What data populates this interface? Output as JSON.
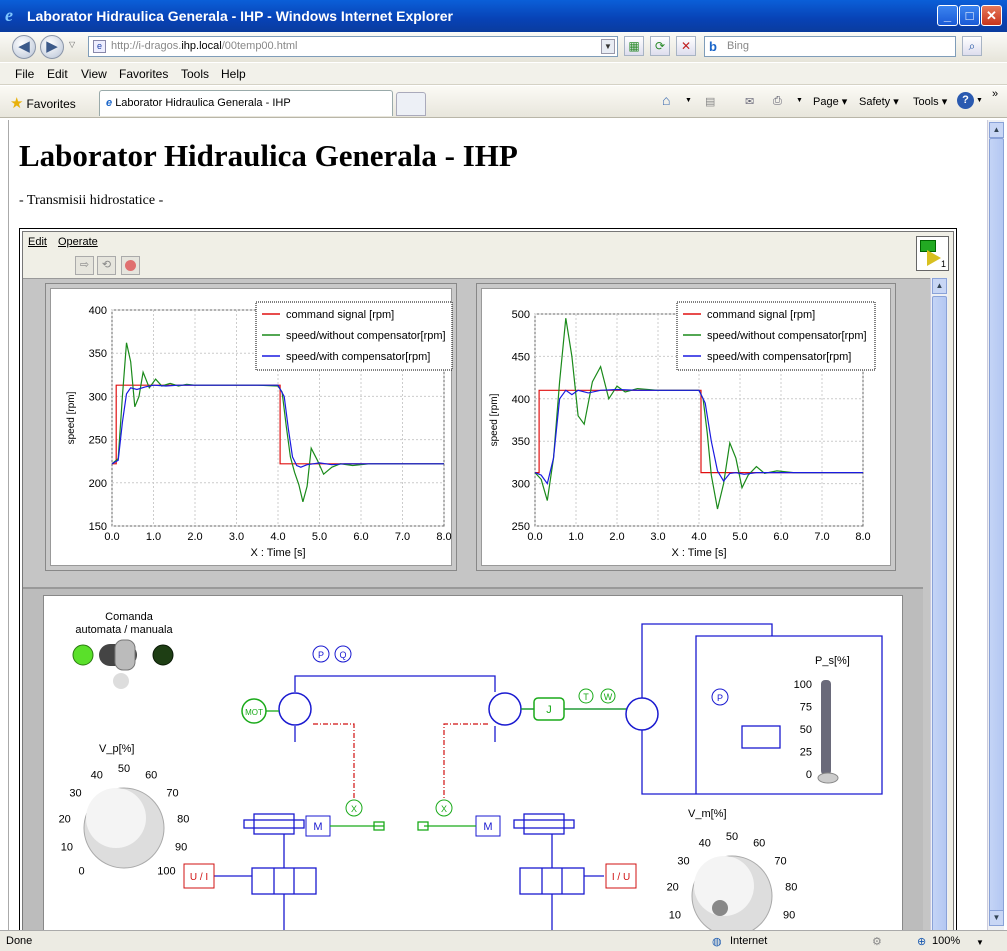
{
  "window": {
    "title": "Laborator Hidraulica Generala - IHP - Windows Internet Explorer"
  },
  "address": {
    "prefix": "http://i-dragos.",
    "host": "ihp.local",
    "path": "/00temp00.html"
  },
  "search": {
    "placeholder": "Bing"
  },
  "menu": [
    "File",
    "Edit",
    "View",
    "Favorites",
    "Tools",
    "Help"
  ],
  "favorites": {
    "label": "Favorites",
    "tab_title": "Laborator Hidraulica Generala - IHP"
  },
  "commandbar": {
    "page": "Page",
    "safety": "Safety",
    "tools": "Tools"
  },
  "page": {
    "title": "Laborator Hidraulica Generala - IHP",
    "subtitle": "- Transmisii hidrostatice -"
  },
  "vi": {
    "menu": [
      "Edit",
      "Operate"
    ],
    "icon_label": "1",
    "switch_label_1": "Comanda",
    "switch_label_2": "automata / manuala",
    "knob_pump_label": "V_p[%]",
    "knob_motor_label": "V_m[%]",
    "slider_label": "P_s[%]",
    "knob_ticks": [
      "0",
      "10",
      "20",
      "30",
      "40",
      "50",
      "60",
      "70",
      "80",
      "90",
      "100"
    ],
    "slider_ticks": [
      "100",
      "75",
      "50",
      "25",
      "0"
    ],
    "blocks": {
      "mot": "MOT",
      "m": "M",
      "j": "J",
      "p": "P",
      "q": "Q",
      "t": "T",
      "w": "W",
      "x": "X",
      "ui": "U / I",
      "iu": "I / U"
    }
  },
  "chart_data": [
    {
      "type": "line",
      "xlabel": "X : Time [s]",
      "ylabel": "speed [rpm]",
      "xlim": [
        0,
        8
      ],
      "ylim": [
        150,
        400
      ],
      "xticks": [
        "0.0",
        "1.0",
        "2.0",
        "3.0",
        "4.0",
        "5.0",
        "6.0",
        "7.0",
        "8.0"
      ],
      "yticks": [
        "150",
        "200",
        "250",
        "300",
        "350",
        "400"
      ],
      "legend_position": "top-right",
      "series": [
        {
          "name": "command signal [rpm]",
          "color": "#e01010",
          "x": [
            0,
            0.1,
            0.1,
            4.05,
            4.05,
            8
          ],
          "y": [
            222,
            222,
            313,
            313,
            222,
            222
          ]
        },
        {
          "name": "speed/without compensator[rpm]",
          "color": "#1a8a1a",
          "x": [
            0,
            0.15,
            0.25,
            0.35,
            0.45,
            0.55,
            0.65,
            0.75,
            0.9,
            1.05,
            1.2,
            1.4,
            1.6,
            1.8,
            2.0,
            2.5,
            3.0,
            3.5,
            4.0,
            4.1,
            4.2,
            4.3,
            4.4,
            4.5,
            4.6,
            4.7,
            4.8,
            4.95,
            5.1,
            5.3,
            5.5,
            5.8,
            6.2,
            7,
            8
          ],
          "y": [
            222,
            228,
            300,
            362,
            340,
            288,
            300,
            328,
            310,
            320,
            312,
            315,
            312,
            314,
            313,
            313,
            313,
            313,
            312,
            305,
            265,
            230,
            212,
            198,
            178,
            196,
            240,
            226,
            210,
            218,
            222,
            220,
            222,
            222,
            222
          ]
        },
        {
          "name": "speed/with compensator[rpm]",
          "color": "#1a1ae0",
          "x": [
            0,
            0.15,
            0.25,
            0.35,
            0.45,
            0.6,
            0.8,
            1.0,
            1.3,
            1.6,
            2.0,
            3.0,
            4.0,
            4.15,
            4.25,
            4.35,
            4.45,
            4.55,
            4.7,
            4.85,
            5.0,
            5.3,
            5.6,
            6.0,
            7,
            8
          ],
          "y": [
            222,
            226,
            270,
            303,
            310,
            308,
            311,
            313,
            312,
            313,
            313,
            313,
            313,
            300,
            262,
            230,
            220,
            218,
            221,
            222,
            223,
            221,
            222,
            222,
            222,
            222
          ]
        }
      ]
    },
    {
      "type": "line",
      "xlabel": "X : Time [s]",
      "ylabel": "speed [rpm]",
      "xlim": [
        0,
        8
      ],
      "ylim": [
        250,
        500
      ],
      "xticks": [
        "0.0",
        "1.0",
        "2.0",
        "3.0",
        "4.0",
        "5.0",
        "6.0",
        "7.0",
        "8.0"
      ],
      "yticks": [
        "250",
        "300",
        "350",
        "400",
        "450",
        "500"
      ],
      "legend_position": "top-right",
      "series": [
        {
          "name": "command signal [rpm]",
          "color": "#e01010",
          "x": [
            0,
            0.1,
            0.1,
            4.05,
            4.05,
            8
          ],
          "y": [
            313,
            313,
            410,
            410,
            313,
            313
          ]
        },
        {
          "name": "speed/without compensator[rpm]",
          "color": "#1a8a1a",
          "x": [
            0,
            0.15,
            0.3,
            0.45,
            0.6,
            0.75,
            0.9,
            1.05,
            1.2,
            1.4,
            1.6,
            1.8,
            2.0,
            2.2,
            2.5,
            3.0,
            3.5,
            4.0,
            4.1,
            4.2,
            4.3,
            4.45,
            4.6,
            4.75,
            4.9,
            5.05,
            5.2,
            5.4,
            5.6,
            5.9,
            6.3,
            7,
            8
          ],
          "y": [
            313,
            305,
            280,
            330,
            420,
            495,
            450,
            380,
            370,
            420,
            438,
            400,
            415,
            408,
            412,
            410,
            410,
            410,
            400,
            360,
            310,
            270,
            300,
            348,
            330,
            295,
            310,
            320,
            312,
            315,
            313,
            313,
            313
          ]
        },
        {
          "name": "speed/with compensator[rpm]",
          "color": "#1a1ae0",
          "x": [
            0,
            0.15,
            0.3,
            0.45,
            0.6,
            0.75,
            0.9,
            1.05,
            1.3,
            1.6,
            2.0,
            2.5,
            3.0,
            4.0,
            4.15,
            4.3,
            4.45,
            4.6,
            4.75,
            4.9,
            5.1,
            5.4,
            6,
            7,
            8
          ],
          "y": [
            313,
            310,
            300,
            330,
            400,
            410,
            405,
            410,
            407,
            410,
            411,
            410,
            410,
            410,
            395,
            350,
            315,
            303,
            312,
            313,
            311,
            313,
            313,
            313,
            313
          ]
        }
      ]
    }
  ],
  "status": {
    "left": "Done",
    "zone": "Internet",
    "zoom": "100%"
  }
}
